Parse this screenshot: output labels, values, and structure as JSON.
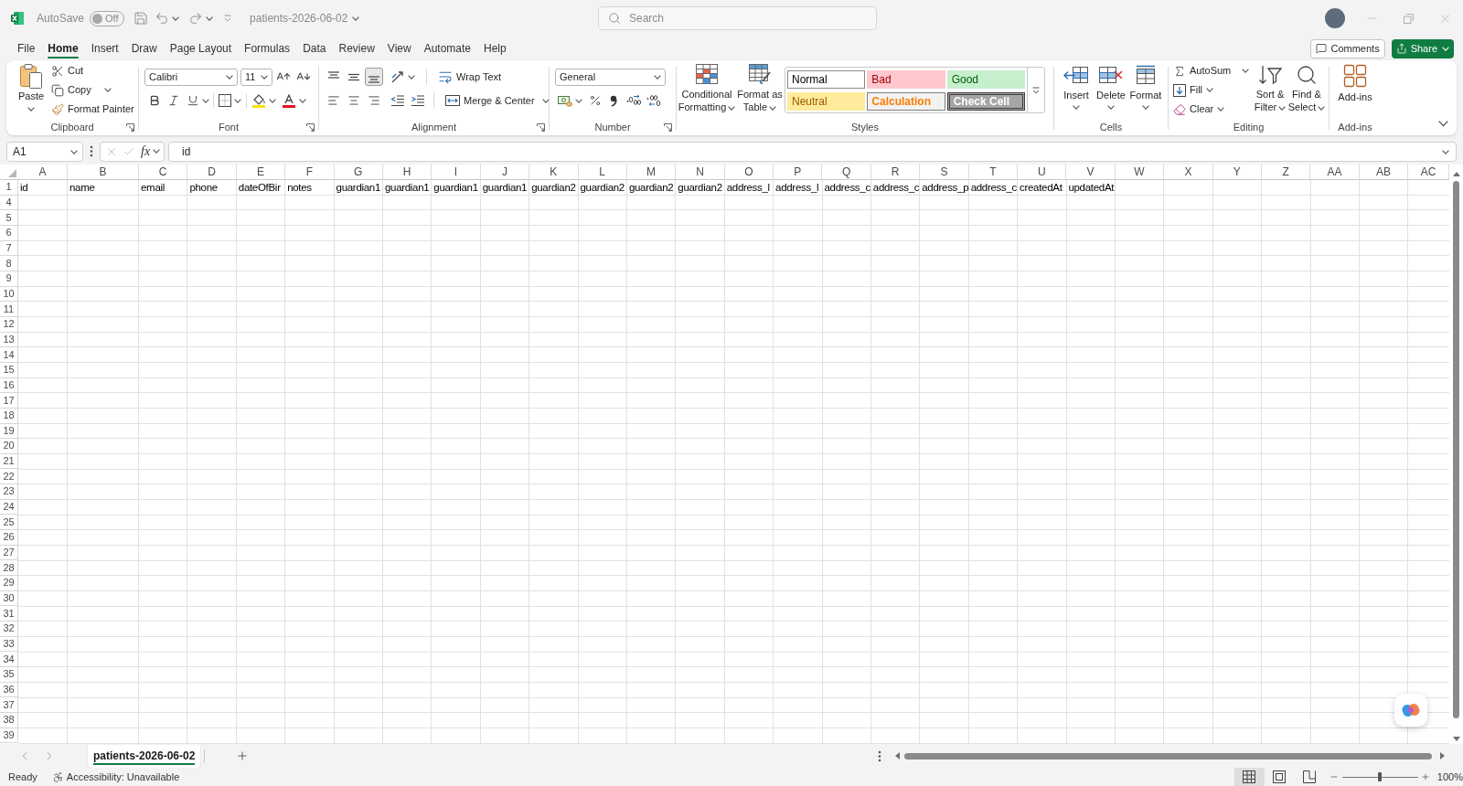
{
  "title_bar": {
    "autosave": {
      "label": "AutoSave",
      "on": false,
      "state": "Off"
    },
    "file_name": "patients-2026-06-02",
    "search": {
      "placeholder": "Search"
    }
  },
  "menu_tabs": [
    {
      "label": "File",
      "selected": false
    },
    {
      "label": "Home",
      "selected": true
    },
    {
      "label": "Insert",
      "selected": false
    },
    {
      "label": "Draw",
      "selected": false
    },
    {
      "label": "Page Layout",
      "selected": false
    },
    {
      "label": "Formulas",
      "selected": false
    },
    {
      "label": "Data",
      "selected": false
    },
    {
      "label": "Review",
      "selected": false
    },
    {
      "label": "View",
      "selected": false
    },
    {
      "label": "Automate",
      "selected": false
    },
    {
      "label": "Help",
      "selected": false
    }
  ],
  "header_buttons": {
    "comments": "Comments",
    "share": "Share"
  },
  "ribbon": {
    "clipboard": {
      "label": "Clipboard",
      "paste": "Paste",
      "cut": "Cut",
      "copy": "Copy",
      "format_painter": "Format Painter"
    },
    "font": {
      "label": "Font",
      "font_name": "Calibri",
      "font_size": "11"
    },
    "alignment": {
      "label": "Alignment",
      "vertical": [
        {
          "kind": "top",
          "selected": false
        },
        {
          "kind": "middle",
          "selected": false
        },
        {
          "kind": "bottom",
          "selected": true
        }
      ],
      "horizontal": [
        {
          "kind": "left",
          "selected": false
        },
        {
          "kind": "center",
          "selected": false
        },
        {
          "kind": "right",
          "selected": false
        }
      ],
      "wrap_text": "Wrap Text",
      "merge_center": "Merge & Center"
    },
    "number": {
      "label": "Number",
      "format": "General"
    },
    "styles": {
      "label": "Styles",
      "conditional_formatting": "Conditional Formatting",
      "format_as_table": "Format as Table",
      "cell_styles": [
        {
          "label": "Normal",
          "kind": "normal"
        },
        {
          "label": "Bad",
          "kind": "bad"
        },
        {
          "label": "Good",
          "kind": "good"
        },
        {
          "label": "Neutral",
          "kind": "neutral"
        },
        {
          "label": "Calculation",
          "kind": "calculation"
        },
        {
          "label": "Check Cell",
          "kind": "check"
        }
      ]
    },
    "cells": {
      "label": "Cells",
      "buttons": [
        {
          "label": "Insert",
          "kind": "insert"
        },
        {
          "label": "Delete",
          "kind": "delete"
        },
        {
          "label": "Format",
          "kind": "format"
        }
      ]
    },
    "editing": {
      "label": "Editing",
      "autosum": "AutoSum",
      "fill": "Fill",
      "clear": "Clear",
      "sort_filter": "Sort & Filter",
      "find_select": "Find & Select"
    },
    "add_ins": {
      "label": "Add-ins",
      "button": "Add-ins"
    }
  },
  "formula_bar": {
    "name_box": "A1",
    "insert_function": "fx",
    "value": "id"
  },
  "sheet": {
    "columns": [
      "A",
      "B",
      "C",
      "D",
      "E",
      "F",
      "G",
      "H",
      "I",
      "J",
      "K",
      "L",
      "M",
      "N",
      "O",
      "P",
      "Q",
      "R",
      "S",
      "T",
      "U",
      "V",
      "W",
      "X",
      "Y",
      "Z",
      "AA",
      "AB",
      "AC"
    ],
    "rows": [
      {
        "number": "1",
        "cells": [
          "id",
          "name",
          "email",
          "phone",
          "dateOfBir",
          "notes",
          "guardian1",
          "guardian1",
          "guardian1",
          "guardian1",
          "guardian2",
          "guardian2",
          "guardian2",
          "guardian2",
          "address_l",
          "address_l",
          "address_c",
          "address_c",
          "address_p",
          "address_c",
          "createdAt",
          "updatedAt"
        ]
      },
      {
        "number": "4"
      },
      {
        "number": "5"
      },
      {
        "number": "6"
      },
      {
        "number": "7"
      },
      {
        "number": "8"
      },
      {
        "number": "9"
      },
      {
        "number": "10"
      },
      {
        "number": "11"
      },
      {
        "number": "12"
      },
      {
        "number": "13"
      },
      {
        "number": "14"
      },
      {
        "number": "15"
      },
      {
        "number": "16"
      },
      {
        "number": "17"
      },
      {
        "number": "18"
      },
      {
        "number": "19"
      },
      {
        "number": "20"
      },
      {
        "number": "21"
      },
      {
        "number": "22"
      },
      {
        "number": "23"
      },
      {
        "number": "24"
      },
      {
        "number": "25"
      },
      {
        "number": "26"
      },
      {
        "number": "27"
      },
      {
        "number": "28"
      },
      {
        "number": "29"
      },
      {
        "number": "30"
      },
      {
        "number": "31"
      },
      {
        "number": "32"
      },
      {
        "number": "33"
      },
      {
        "number": "34"
      },
      {
        "number": "35"
      },
      {
        "number": "36"
      },
      {
        "number": "37"
      },
      {
        "number": "38"
      },
      {
        "number": "39"
      }
    ]
  },
  "sheet_tabs": [
    {
      "label": "patients-2026-06-02",
      "selected": true
    }
  ],
  "status_bar": {
    "status": "Ready",
    "accessibility": "Accessibility: Unavailable",
    "views": [
      {
        "kind": "normal",
        "selected": true
      },
      {
        "kind": "page_layout",
        "selected": false
      },
      {
        "kind": "page_break",
        "selected": false
      }
    ],
    "zoom": {
      "level": 0.5,
      "reading": "100%"
    }
  }
}
